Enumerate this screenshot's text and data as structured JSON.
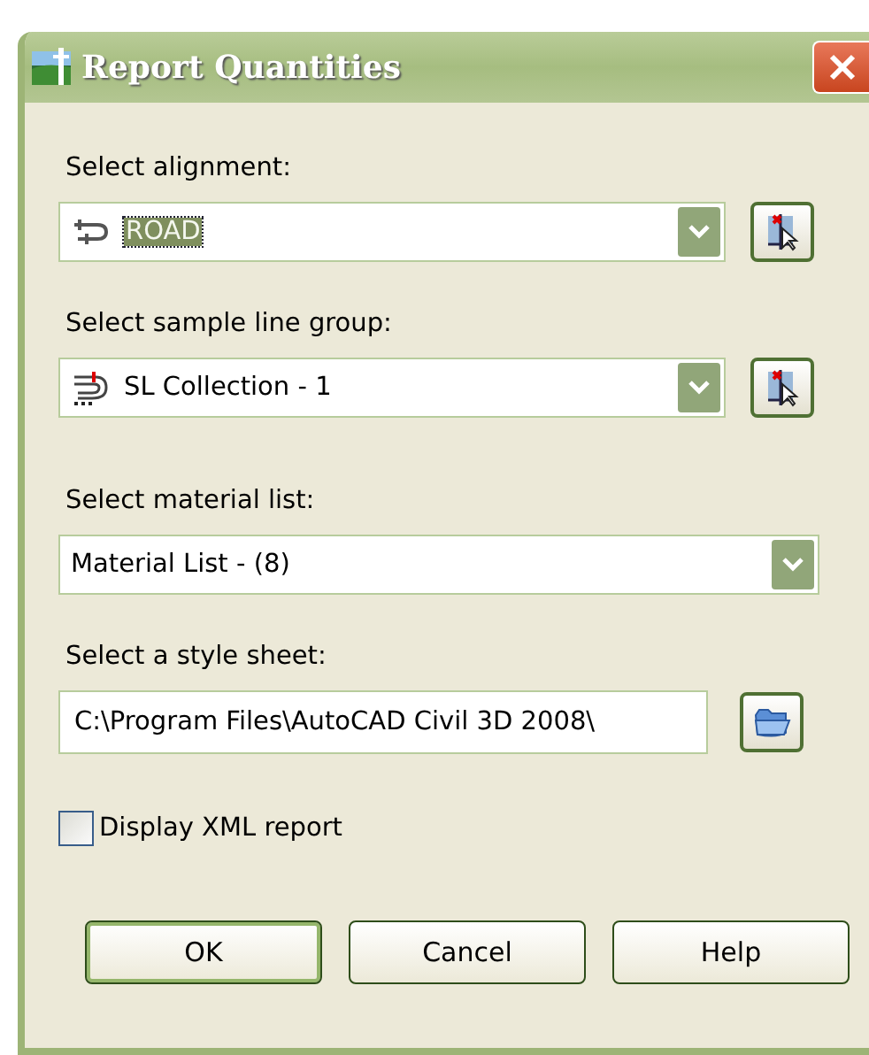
{
  "window": {
    "title": "Report Quantities"
  },
  "fields": [
    {
      "kind": "alignment",
      "label": "Select alignment:",
      "value": "ROAD",
      "value_selected": true
    },
    {
      "kind": "sampleline",
      "label": "Select sample line group:",
      "value": "SL Collection - 1",
      "value_selected": false
    },
    {
      "kind": "list",
      "label": "Select material list:",
      "value": "Material List - (8)",
      "value_selected": false
    },
    {
      "kind": "path",
      "label": "Select a style sheet:",
      "value": "C:\\Program Files\\AutoCAD Civil 3D 2008\\"
    }
  ],
  "checkbox": {
    "label": "Display XML report",
    "checked": false
  },
  "buttons": [
    {
      "label": "OK",
      "default": true
    },
    {
      "label": "Cancel",
      "default": false
    },
    {
      "label": "Help",
      "default": false
    }
  ]
}
